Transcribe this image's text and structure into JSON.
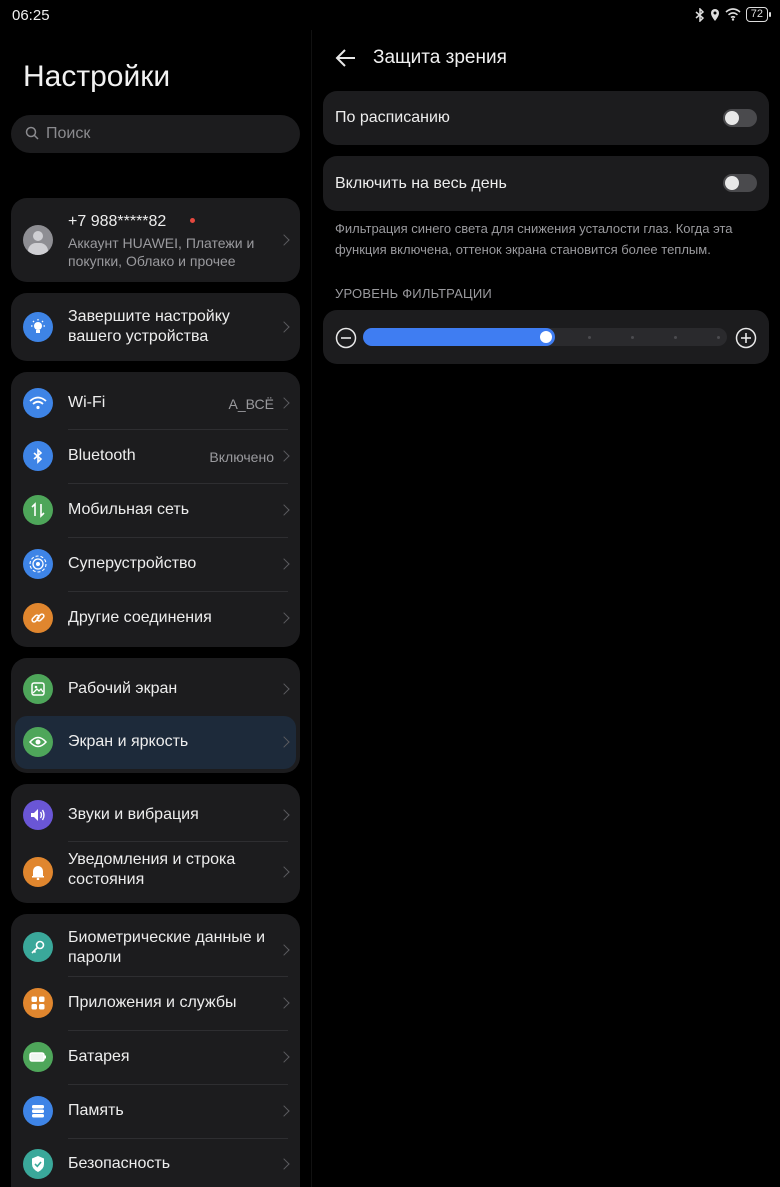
{
  "status": {
    "time": "06:25",
    "battery": "72"
  },
  "left": {
    "title": "Настройки",
    "search_placeholder": "Поиск",
    "account": {
      "phone": "+7 988*****82",
      "line1": "Аккаунт HUAWEI, Платежи и",
      "line2": "покупки, Облако и прочее"
    },
    "setup": {
      "line1": "Завершите настройку",
      "line2": "вашего устройства"
    },
    "connectivity": [
      {
        "label": "Wi-Fi",
        "value": "A_ВСЁ",
        "icon": "wifi-icon",
        "color": "#3e84e6"
      },
      {
        "label": "Bluetooth",
        "value": "Включено",
        "icon": "bluetooth-icon",
        "color": "#3e84e6"
      },
      {
        "label": "Мобильная сеть",
        "value": "",
        "icon": "mobile-network-icon",
        "color": "#4ea65a"
      },
      {
        "label": "Суперустройство",
        "value": "",
        "icon": "super-device-icon",
        "color": "#3e84e6"
      },
      {
        "label": "Другие соединения",
        "value": "",
        "icon": "link-icon",
        "color": "#e0862e"
      }
    ],
    "display": [
      {
        "label": "Рабочий экран",
        "icon": "home-screen-icon",
        "color": "#4ea65a"
      },
      {
        "label": "Экран и яркость",
        "icon": "eye-icon",
        "color": "#4ea65a"
      }
    ],
    "sound": [
      {
        "label": "Звуки и вибрация",
        "icon": "speaker-icon",
        "color": "#6a56d6"
      },
      {
        "label1": "Уведомления и строка",
        "label2": "состояния",
        "icon": "bell-icon",
        "color": "#e0862e"
      }
    ],
    "system": [
      {
        "label1": "Биометрические данные и",
        "label2": "пароли",
        "icon": "key-icon",
        "color": "#3aa89a"
      },
      {
        "label": "Приложения и службы",
        "icon": "apps-icon",
        "color": "#e0862e"
      },
      {
        "label": "Батарея",
        "icon": "battery-icon",
        "color": "#4ea65a"
      },
      {
        "label": "Память",
        "icon": "storage-icon",
        "color": "#3e84e6"
      },
      {
        "label": "Безопасность",
        "icon": "shield-icon",
        "color": "#3aa89a"
      }
    ]
  },
  "right": {
    "title": "Защита зрения",
    "schedule_label": "По расписанию",
    "schedule_on": false,
    "allday_label": "Включить на весь день",
    "allday_on": false,
    "description": "Фильтрация синего света для снижения усталости глаз. Когда эта функция включена, оттенок экрана становится более теплым.",
    "filter_section": "УРОВЕНЬ ФИЛЬТРАЦИИ",
    "filter_level": 0.5
  },
  "colors": {
    "accent": "#3f7df2",
    "card": "#1c1c1e",
    "background": "#000000"
  }
}
